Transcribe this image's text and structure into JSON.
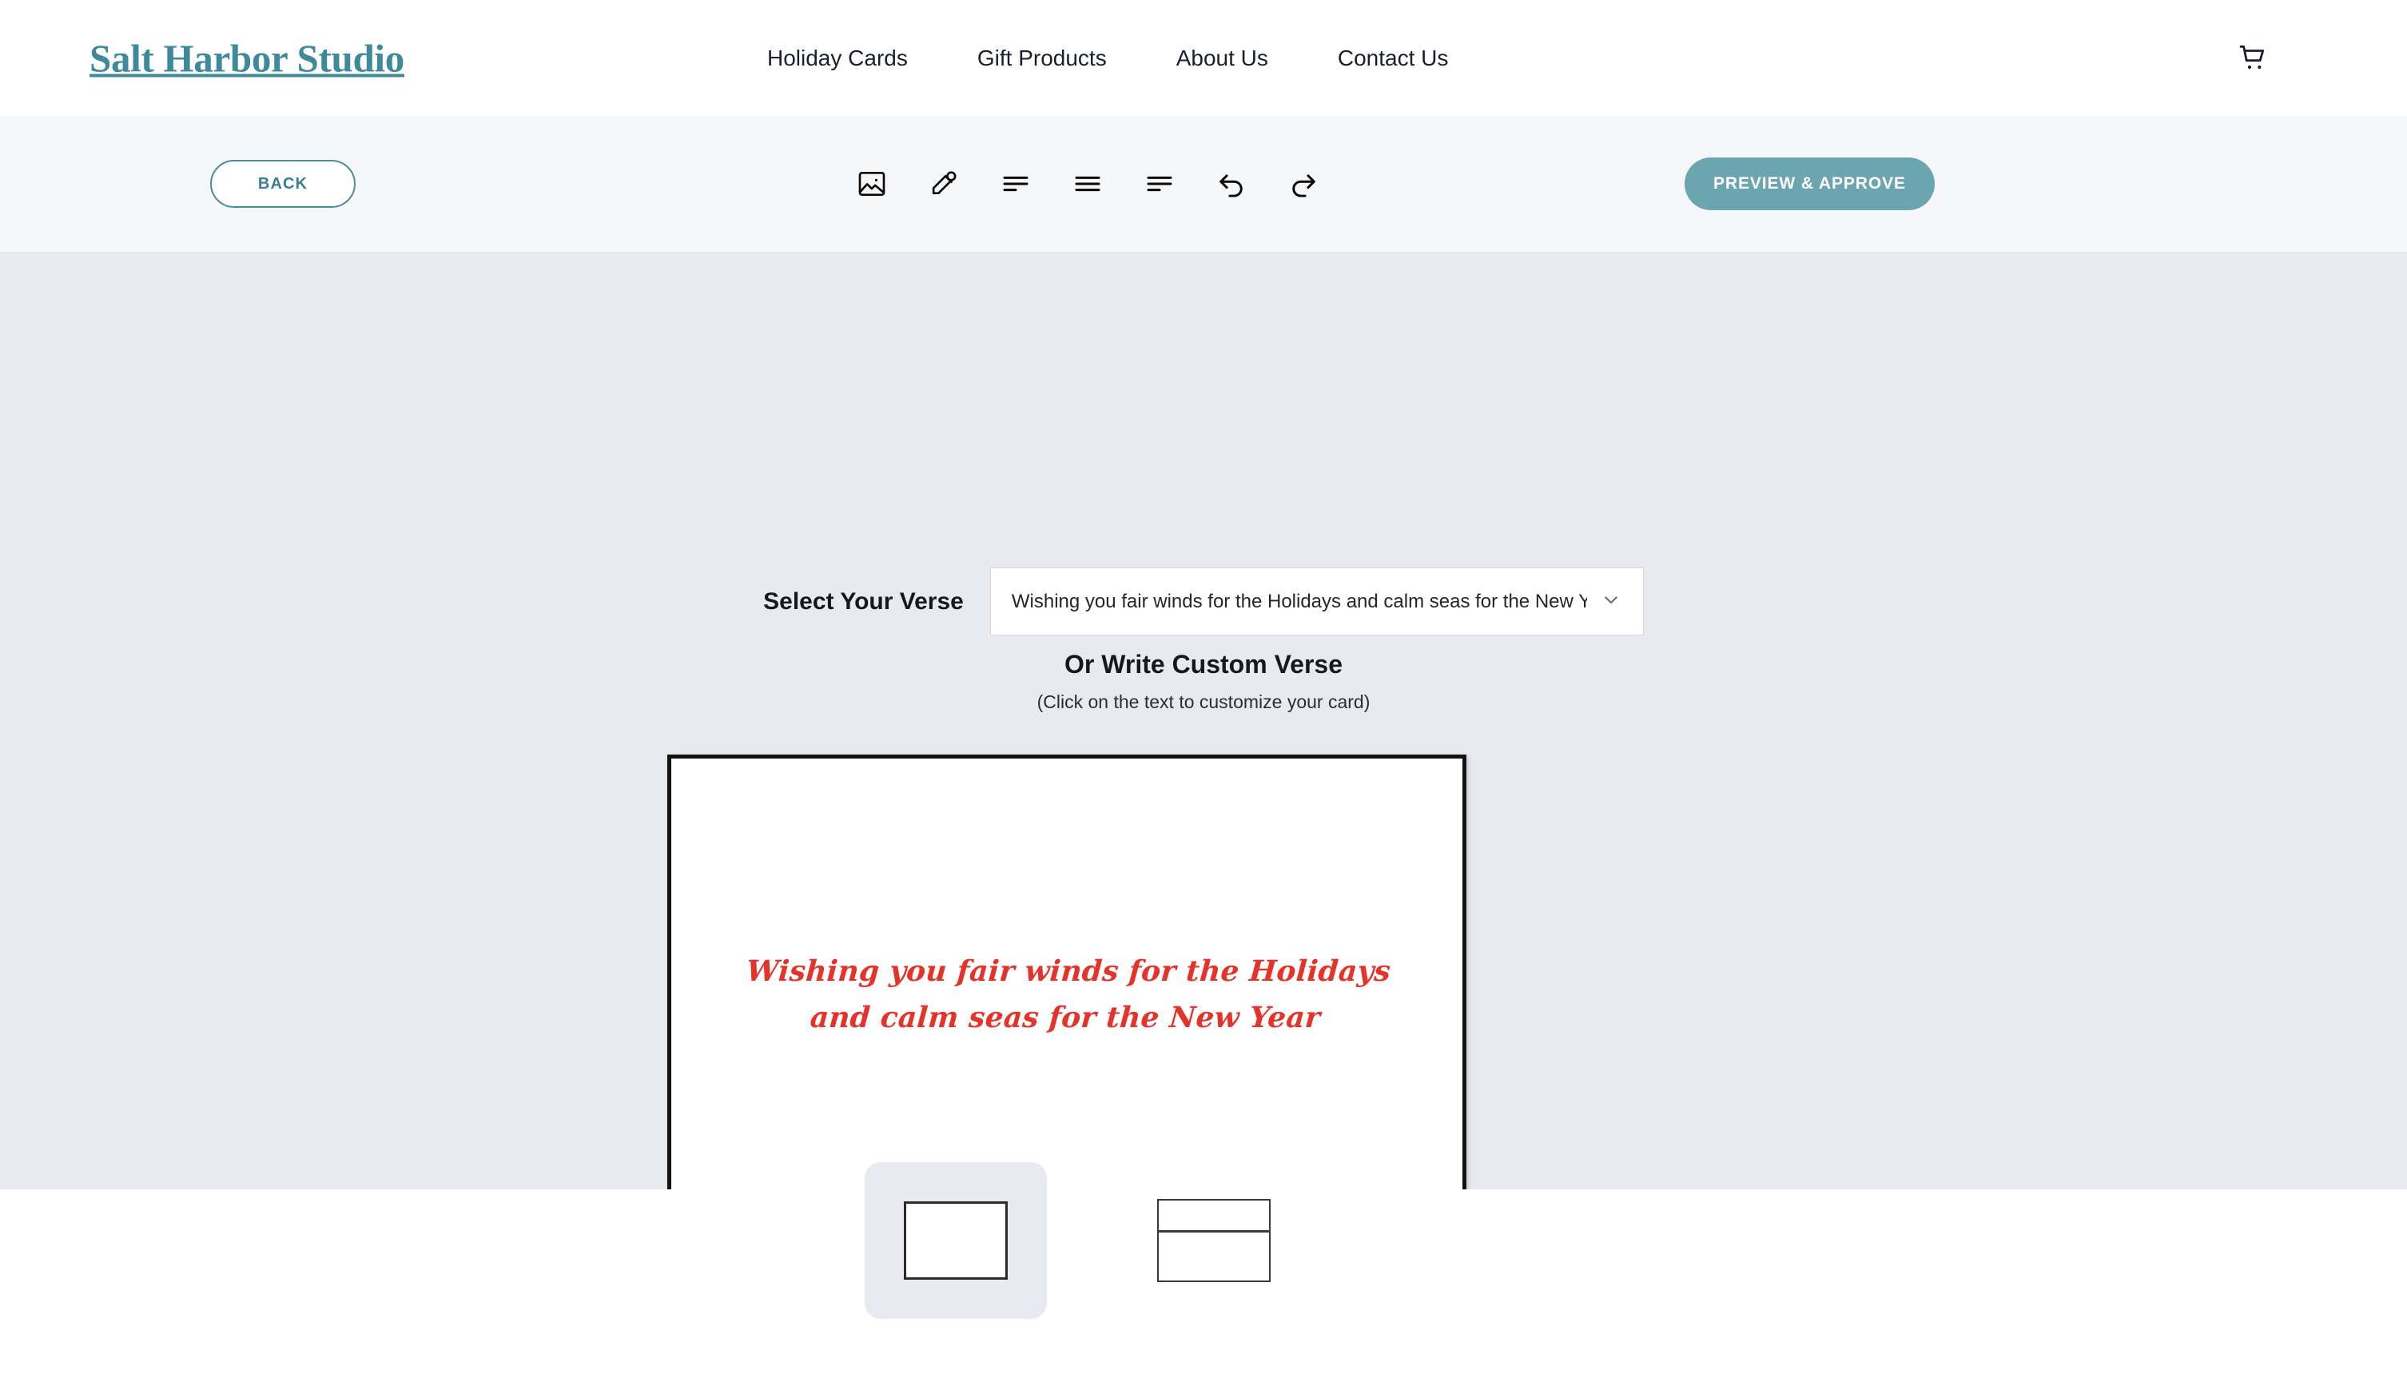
{
  "header": {
    "brand": "Salt Harbor Studio",
    "nav": [
      {
        "label": "Holiday Cards"
      },
      {
        "label": "Gift Products"
      },
      {
        "label": "About Us"
      },
      {
        "label": "Contact Us"
      }
    ],
    "cart_icon": "shopping-cart-icon"
  },
  "toolbar": {
    "back_label": "BACK",
    "preview_label": "PREVIEW & APPROVE",
    "tools": [
      {
        "name": "image-icon",
        "title": "Image"
      },
      {
        "name": "eyedropper-icon",
        "title": "Color picker"
      },
      {
        "name": "align-left-icon",
        "title": "Align left"
      },
      {
        "name": "align-center-icon",
        "title": "Align center"
      },
      {
        "name": "align-right-icon",
        "title": "Align right"
      },
      {
        "name": "undo-icon",
        "title": "Undo"
      },
      {
        "name": "redo-icon",
        "title": "Redo"
      }
    ]
  },
  "editor": {
    "verse_select_label": "Select Your Verse",
    "verse_selected": "Wishing you fair winds for the Holidays and calm seas for the New Year",
    "verse_chevron_icon": "chevron-down-icon",
    "custom_heading": "Or Write Custom Verse",
    "custom_subtext": "(Click on the text to customize your card)",
    "card": {
      "verse_line_1": "Wishing you fair winds for the Holidays",
      "verse_line_2": "and calm seas for the New Year",
      "text_color": "#e63329",
      "background": "#ffffff",
      "border_color": "#121212"
    }
  },
  "thumbnails": [
    {
      "name": "card-front-thumbnail",
      "type": "card",
      "selected": true
    },
    {
      "name": "envelope-thumbnail",
      "type": "envelope",
      "selected": false
    }
  ],
  "colors": {
    "brand_teal": "#3e8a9b",
    "accent_button": "#6ba5b0",
    "stage_background": "#e8eaef",
    "toolbar_background": "#f6f7f9",
    "card_red": "#e63329"
  }
}
